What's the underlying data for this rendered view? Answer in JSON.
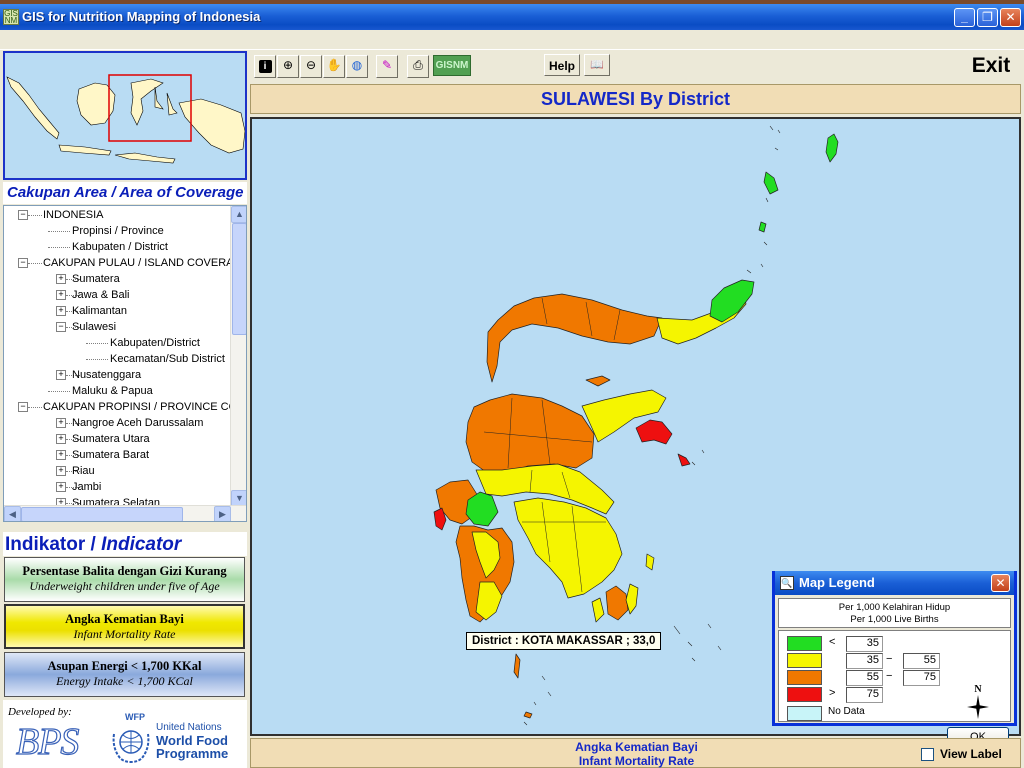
{
  "window": {
    "title": "GIS for Nutrition Mapping of Indonesia",
    "icon_label": "GIS NM",
    "controls": [
      "minimize",
      "restore",
      "close"
    ]
  },
  "coverage": {
    "title_plain": "Cakupan Area / ",
    "title_italic": "Area of Coverage"
  },
  "tree": {
    "items": [
      {
        "label": "INDONESIA",
        "level": 0,
        "toggle": "−"
      },
      {
        "label": "Propinsi / Province",
        "level": 1,
        "toggle": ""
      },
      {
        "label": "Kabupaten / District",
        "level": 1,
        "toggle": ""
      },
      {
        "label": "CAKUPAN PULAU / ISLAND COVERAG",
        "level": 0,
        "toggle": "−"
      },
      {
        "label": "Sumatera",
        "level": 1,
        "toggle": "+"
      },
      {
        "label": "Jawa & Bali",
        "level": 1,
        "toggle": "+"
      },
      {
        "label": "Kalimantan",
        "level": 1,
        "toggle": "+"
      },
      {
        "label": "Sulawesi",
        "level": 1,
        "toggle": "−"
      },
      {
        "label": "Kabupaten/District",
        "level": 2,
        "toggle": ""
      },
      {
        "label": "Kecamatan/Sub District",
        "level": 2,
        "toggle": ""
      },
      {
        "label": "Nusatenggara",
        "level": 1,
        "toggle": "+"
      },
      {
        "label": "Maluku & Papua",
        "level": 1,
        "toggle": ""
      },
      {
        "label": "CAKUPAN PROPINSI / PROVINCE COV",
        "level": 0,
        "toggle": "−"
      },
      {
        "label": "Nangroe Aceh Darussalam",
        "level": 1,
        "toggle": "+"
      },
      {
        "label": "Sumatera Utara",
        "level": 1,
        "toggle": "+"
      },
      {
        "label": "Sumatera Barat",
        "level": 1,
        "toggle": "+"
      },
      {
        "label": "Riau",
        "level": 1,
        "toggle": "+"
      },
      {
        "label": "Jambi",
        "level": 1,
        "toggle": "+"
      },
      {
        "label": "Sumatera Selatan",
        "level": 1,
        "toggle": "+"
      }
    ]
  },
  "indicator": {
    "title_plain": "Indikator / ",
    "title_italic": "Indicator",
    "buttons": [
      {
        "label_id": "Persentase Balita dengan Gizi Kurang",
        "label_en": "Underweight children under five of Age",
        "selected": false
      },
      {
        "label_id": "Angka Kematian Bayi",
        "label_en": "Infant Mortality Rate",
        "selected": true
      },
      {
        "label_id": "Asupan Energi < 1,700 KKal",
        "label_en": "Energy Intake < 1,700 KCal",
        "selected": false
      }
    ]
  },
  "credits": {
    "developed_by": "Developed by:",
    "bps": "BPS",
    "wfp": "WFP",
    "un_line1": "United Nations",
    "un_line2": "World Food",
    "un_line3": "Programme"
  },
  "toolbar": {
    "buttons": [
      {
        "name": "info-icon",
        "glyph": "i"
      },
      {
        "name": "zoom-in-icon",
        "glyph": "⊕"
      },
      {
        "name": "zoom-out-icon",
        "glyph": "⊖"
      },
      {
        "name": "pan-hand-icon",
        "glyph": "✋"
      },
      {
        "name": "globe-icon",
        "glyph": "◍"
      },
      {
        "name": "select-icon",
        "glyph": "✎"
      },
      {
        "name": "print-icon",
        "glyph": "⎙"
      }
    ],
    "gisnm_label": "GISNM",
    "help_label": "Help",
    "book_glyph": "📖",
    "exit_label": "Exit"
  },
  "map": {
    "title": "SULAWESI By District",
    "tooltip": "District : KOTA MAKASSAR ; 33,0",
    "colors": {
      "sea": "#b9dcf3",
      "green": "#22dd22",
      "yellow": "#f5f500",
      "orange": "#f07800",
      "red": "#ee1010",
      "no_data": "#c8f4f8",
      "border": "#222222"
    }
  },
  "legend": {
    "title": "Map Legend",
    "subtitle_1": "Per 1,000 Kelahiran Hidup",
    "subtitle_2": "Per 1,000 Live Births",
    "rows": [
      {
        "color": "#22dd22",
        "op": "<",
        "from": "35",
        "dash": "",
        "to": ""
      },
      {
        "color": "#f5f500",
        "op": "",
        "from": "35",
        "dash": "−",
        "to": "55"
      },
      {
        "color": "#f07800",
        "op": "",
        "from": "55",
        "dash": "−",
        "to": "75"
      },
      {
        "color": "#ee1010",
        "op": ">",
        "from": "75",
        "dash": "",
        "to": ""
      }
    ],
    "no_data_label": "No Data",
    "no_data_color": "#c8f4f8",
    "ok_label": "OK",
    "north": "N"
  },
  "bottom": {
    "label_1": "Angka Kematian Bayi",
    "label_2": "Infant Mortality Rate",
    "view_label": "View Label"
  }
}
